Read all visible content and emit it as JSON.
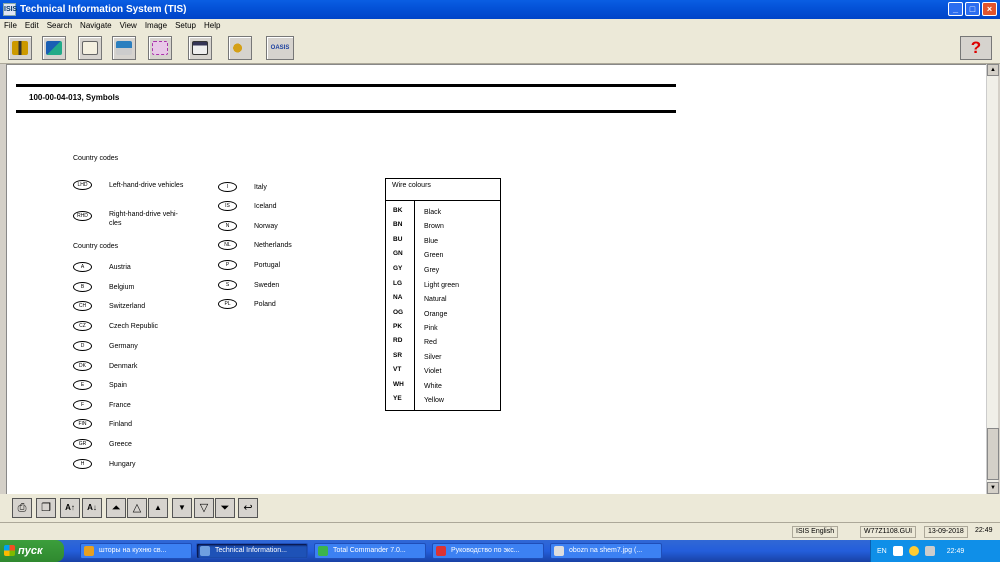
{
  "window": {
    "title": "Technical Information System (TIS)",
    "app_icon": "ISIS"
  },
  "window_buttons": {
    "minimize": "_",
    "maximize": "□",
    "close": "×"
  },
  "menu": [
    "File",
    "Edit",
    "Search",
    "Navigate",
    "View",
    "Image",
    "Setup",
    "Help"
  ],
  "toolbar": {
    "icons": [
      "exit-icon",
      "tools-icon",
      "document-icon",
      "print-icon",
      "diagram-icon",
      "display-icon",
      "key-icon",
      "oasis-icon"
    ],
    "oasis_label": "OASIS",
    "help_label": "?"
  },
  "document": {
    "title": "100-00-04-013, Symbols",
    "section_country_codes_1": "Country codes",
    "section_country_codes_2": "Country codes",
    "drive_codes": [
      {
        "code": "LHD",
        "label": "Left-hand-drive vehicles"
      },
      {
        "code": "RHD",
        "label": "Right-hand-drive vehi-",
        "label2": "cles"
      }
    ],
    "countries_left": [
      {
        "code": "A",
        "name": "Austria"
      },
      {
        "code": "B",
        "name": "Belgium"
      },
      {
        "code": "CH",
        "name": "Switzerland"
      },
      {
        "code": "CZ",
        "name": "Czech Republic"
      },
      {
        "code": "D",
        "name": "Germany"
      },
      {
        "code": "DK",
        "name": "Denmark"
      },
      {
        "code": "E",
        "name": "Spain"
      },
      {
        "code": "F",
        "name": "France"
      },
      {
        "code": "FIN",
        "name": "Finland"
      },
      {
        "code": "GR",
        "name": "Greece"
      },
      {
        "code": "H",
        "name": "Hungary"
      }
    ],
    "countries_right": [
      {
        "code": "I",
        "name": "Italy"
      },
      {
        "code": "IS",
        "name": "Iceland"
      },
      {
        "code": "N",
        "name": "Norway"
      },
      {
        "code": "NL",
        "name": "Netherlands"
      },
      {
        "code": "P",
        "name": "Portugal"
      },
      {
        "code": "S",
        "name": "Sweden"
      },
      {
        "code": "PL",
        "name": "Poland"
      }
    ],
    "wire_colours": {
      "header": "Wire colours",
      "rows": [
        {
          "abbr": "BK",
          "colour": "Black"
        },
        {
          "abbr": "BN",
          "colour": "Brown"
        },
        {
          "abbr": "BU",
          "colour": "Blue"
        },
        {
          "abbr": "GN",
          "colour": "Green"
        },
        {
          "abbr": "GY",
          "colour": "Grey"
        },
        {
          "abbr": "LG",
          "colour": "Light green"
        },
        {
          "abbr": "NA",
          "colour": "Natural"
        },
        {
          "abbr": "OG",
          "colour": "Orange"
        },
        {
          "abbr": "PK",
          "colour": "Pink"
        },
        {
          "abbr": "RD",
          "colour": "Red"
        },
        {
          "abbr": "SR",
          "colour": "Silver"
        },
        {
          "abbr": "VT",
          "colour": "Violet"
        },
        {
          "abbr": "WH",
          "colour": "White"
        },
        {
          "abbr": "YE",
          "colour": "Yellow"
        }
      ]
    }
  },
  "bottom_toolbar": {
    "icons": [
      "print-icon",
      "copy-icon",
      "font-larger-icon",
      "font-smaller-icon",
      "first-page-icon",
      "page-up-icon",
      "line-up-icon",
      "line-down-icon",
      "page-down-icon",
      "last-page-icon",
      "back-icon"
    ],
    "font_larger_label": "A↑",
    "font_smaller_label": "A↓"
  },
  "status": {
    "language": "ISIS English",
    "file": "W77Z1108.GUI",
    "date": "13-09-2018",
    "time": "22:49"
  },
  "taskbar": {
    "start_label": "пуск",
    "tasks": [
      {
        "label": "шторы на кухню св...",
        "icon_color": "#e8a020"
      },
      {
        "label": "Technical Information...",
        "icon_color": "#6fa0e0"
      },
      {
        "label": "Total Commander 7.0...",
        "icon_color": "#3cb44b"
      },
      {
        "label": "Руководство по экс...",
        "icon_color": "#d33"
      },
      {
        "label": "obozn na shem7.jpg (...",
        "icon_color": "#ddd"
      }
    ],
    "tray": {
      "lang": "EN",
      "time": "22:49"
    }
  }
}
